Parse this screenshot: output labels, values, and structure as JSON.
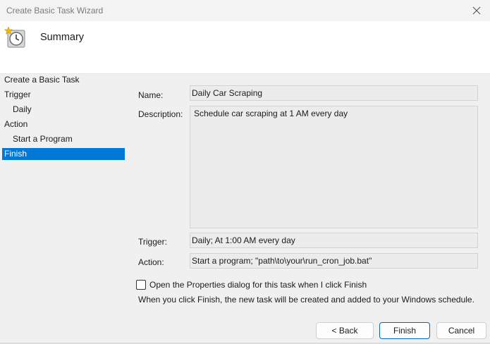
{
  "window": {
    "title": "Create Basic Task Wizard"
  },
  "header": {
    "title": "Summary",
    "icon": "task-clock-icon"
  },
  "nav": {
    "items": [
      {
        "label": "Create a Basic Task",
        "indent": false,
        "active": false
      },
      {
        "label": "Trigger",
        "indent": false,
        "active": false
      },
      {
        "label": "Daily",
        "indent": true,
        "active": false
      },
      {
        "label": "Action",
        "indent": false,
        "active": false
      },
      {
        "label": "Start a Program",
        "indent": true,
        "active": false
      },
      {
        "label": "Finish",
        "indent": false,
        "active": true
      }
    ]
  },
  "summary": {
    "name_label": "Name:",
    "name_value": "Daily Car Scraping",
    "description_label": "Description:",
    "description_value": "Schedule car scraping at 1 AM every day",
    "trigger_label": "Trigger:",
    "trigger_value": "Daily; At 1:00 AM every day",
    "action_label": "Action:",
    "action_value": "Start a program; \"path\\to\\your\\run_cron_job.bat\""
  },
  "options": {
    "open_properties_label": "Open the Properties dialog for this task when I click Finish",
    "open_properties_checked": false
  },
  "info_text": "When you click Finish, the new task will be created and added to your Windows schedule.",
  "buttons": {
    "back": "< Back",
    "finish": "Finish",
    "cancel": "Cancel"
  },
  "colors": {
    "accent": "#0078d7",
    "primary_border": "#0067c0"
  }
}
